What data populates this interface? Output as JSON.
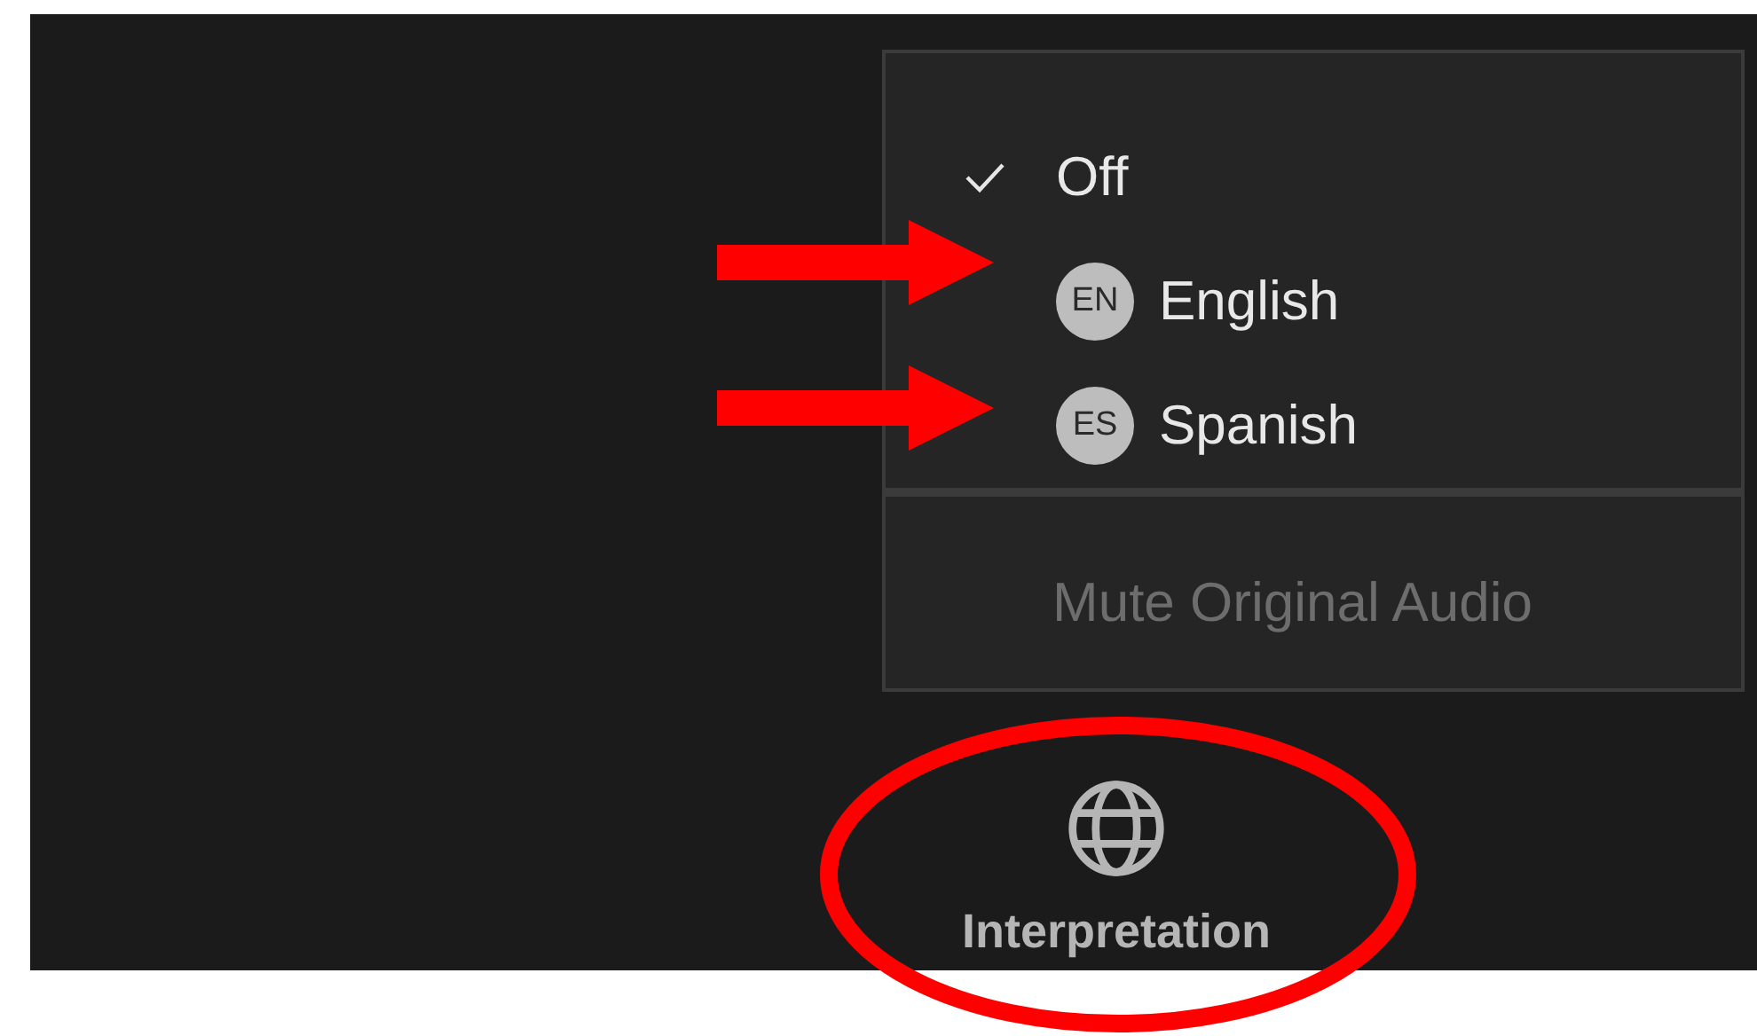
{
  "menu": {
    "items": [
      {
        "kind": "option",
        "label": "Off",
        "checked": true
      },
      {
        "kind": "language",
        "badge": "EN",
        "label": "English",
        "checked": false
      },
      {
        "kind": "language",
        "badge": "ES",
        "label": "Spanish",
        "checked": false
      }
    ],
    "mute": {
      "label": "Mute Original Audio",
      "disabled": true
    }
  },
  "toolbar": {
    "button": {
      "label": "Interpretation"
    }
  }
}
